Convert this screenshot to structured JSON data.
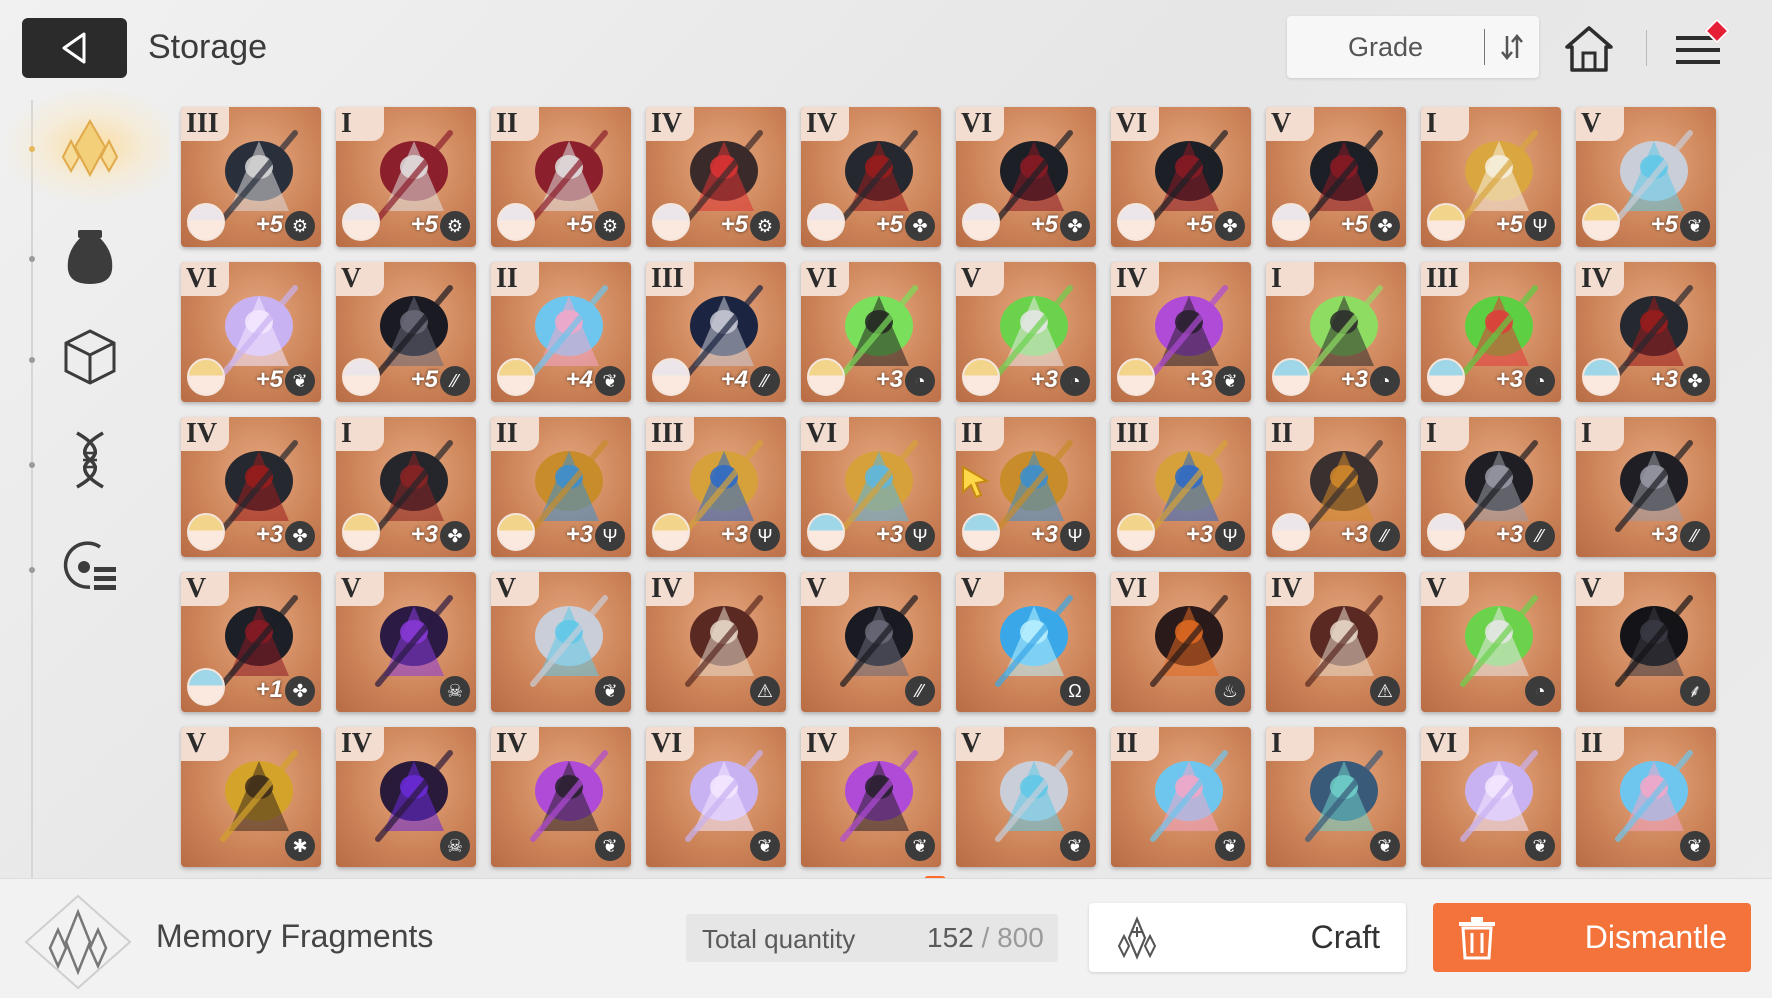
{
  "header": {
    "title": "Storage",
    "sort_label": "Grade"
  },
  "sidebar": {
    "tabs": [
      {
        "name": "memory-fragment-tab",
        "icon": "crystal-icon",
        "active": true
      },
      {
        "name": "pouch-tab",
        "icon": "pouch-icon",
        "active": false
      },
      {
        "name": "cube-tab",
        "icon": "cube-icon",
        "active": false
      },
      {
        "name": "dna-tab",
        "icon": "dna-icon",
        "active": false
      },
      {
        "name": "record-tab",
        "icon": "record-list-icon",
        "active": false
      }
    ]
  },
  "colors": {
    "card_bg": "#cd8459",
    "dismantle_accent": "#f4733a",
    "badge": "#e51f36"
  },
  "items": [
    {
      "grade": "III",
      "item": "goggles",
      "portrait": "white",
      "enh": "+5",
      "attr": "⚙"
    },
    {
      "grade": "I",
      "item": "staff",
      "portrait": "white",
      "enh": "+5",
      "attr": "⚙"
    },
    {
      "grade": "II",
      "item": "staff",
      "portrait": "white",
      "enh": "+5",
      "attr": "⚙"
    },
    {
      "grade": "IV",
      "item": "necklace",
      "portrait": "white",
      "enh": "+5",
      "attr": "⚙"
    },
    {
      "grade": "IV",
      "item": "spiked",
      "portrait": "white",
      "enh": "+5",
      "attr": "✤"
    },
    {
      "grade": "VI",
      "item": "claw",
      "portrait": "white",
      "enh": "+5",
      "attr": "✤"
    },
    {
      "grade": "VI",
      "item": "claw",
      "portrait": "white",
      "enh": "+5",
      "attr": "✤"
    },
    {
      "grade": "V",
      "item": "claw",
      "portrait": "white",
      "enh": "+5",
      "attr": "✤"
    },
    {
      "grade": "I",
      "item": "gold",
      "portrait": "blonde",
      "enh": "+5",
      "attr": "Ψ"
    },
    {
      "grade": "V",
      "item": "wand",
      "portrait": "blonde",
      "enh": "+5",
      "attr": "❦"
    },
    {
      "grade": "VI",
      "item": "feather",
      "portrait": "blonde",
      "enh": "+5",
      "attr": "❦"
    },
    {
      "grade": "V",
      "item": "goblet",
      "portrait": "white",
      "enh": "+5",
      "attr": "⁄⁄"
    },
    {
      "grade": "II",
      "item": "bow",
      "portrait": "blonde",
      "enh": "+4",
      "attr": "❦"
    },
    {
      "grade": "III",
      "item": "orb",
      "portrait": "white",
      "enh": "+4",
      "attr": "⁄⁄"
    },
    {
      "grade": "VI",
      "item": "vials",
      "portrait": "blonde",
      "enh": "+3",
      "attr": "◔"
    },
    {
      "grade": "V",
      "item": "potion",
      "portrait": "blonde",
      "enh": "+3",
      "attr": "◔"
    },
    {
      "grade": "IV",
      "item": "heart",
      "portrait": "blonde",
      "enh": "+3",
      "attr": "❦"
    },
    {
      "grade": "I",
      "item": "vial",
      "portrait": "blue",
      "enh": "+3",
      "attr": "◔"
    },
    {
      "grade": "III",
      "item": "flask",
      "portrait": "blue",
      "enh": "+3",
      "attr": "◔"
    },
    {
      "grade": "IV",
      "item": "spiked",
      "portrait": "blue",
      "enh": "+3",
      "attr": "✤"
    },
    {
      "grade": "IV",
      "item": "spiked",
      "portrait": "blonde",
      "enh": "+3",
      "attr": "✤"
    },
    {
      "grade": "I",
      "item": "chainclaw",
      "portrait": "blonde",
      "enh": "+3",
      "attr": "✤"
    },
    {
      "grade": "II",
      "item": "key",
      "portrait": "blonde",
      "enh": "+3",
      "attr": "Ψ"
    },
    {
      "grade": "III",
      "item": "trident",
      "portrait": "blonde",
      "enh": "+3",
      "attr": "Ψ"
    },
    {
      "grade": "VI",
      "item": "goldwing",
      "portrait": "blue",
      "enh": "+3",
      "attr": "Ψ"
    },
    {
      "grade": "II",
      "item": "key",
      "portrait": "blue",
      "enh": "+3",
      "attr": "Ψ"
    },
    {
      "grade": "III",
      "item": "trident",
      "portrait": "blonde",
      "enh": "+3",
      "attr": "Ψ"
    },
    {
      "grade": "II",
      "item": "gauntlet",
      "portrait": "white",
      "enh": "+3",
      "attr": "⁄⁄"
    },
    {
      "grade": "I",
      "item": "sword",
      "portrait": "white",
      "enh": "+3",
      "attr": "⁄⁄"
    },
    {
      "grade": "I",
      "item": "sword",
      "portrait": "",
      "enh": "+3",
      "attr": "⁄⁄"
    },
    {
      "grade": "V",
      "item": "claw",
      "portrait": "blue",
      "enh": "+1",
      "attr": "✤"
    },
    {
      "grade": "V",
      "item": "darkorb",
      "portrait": "",
      "enh": "",
      "attr": "☠"
    },
    {
      "grade": "V",
      "item": "wand",
      "portrait": "",
      "enh": "",
      "attr": "❦"
    },
    {
      "grade": "IV",
      "item": "charm",
      "portrait": "",
      "enh": "",
      "attr": "⚠"
    },
    {
      "grade": "V",
      "item": "goblet",
      "portrait": "",
      "enh": "",
      "attr": "⁄⁄"
    },
    {
      "grade": "V",
      "item": "water",
      "portrait": "",
      "enh": "",
      "attr": "Ω"
    },
    {
      "grade": "VI",
      "item": "flame",
      "portrait": "",
      "enh": "",
      "attr": "♨"
    },
    {
      "grade": "IV",
      "item": "charm",
      "portrait": "",
      "enh": "",
      "attr": "⚠"
    },
    {
      "grade": "V",
      "item": "potion",
      "portrait": "",
      "enh": "",
      "attr": "◔"
    },
    {
      "grade": "V",
      "item": "darkgoblet",
      "portrait": "",
      "enh": "",
      "attr": "⸙"
    },
    {
      "grade": "V",
      "item": "trophy",
      "portrait": "",
      "enh": "",
      "attr": "✱"
    },
    {
      "grade": "IV",
      "item": "darkchain",
      "portrait": "",
      "enh": "",
      "attr": "☠"
    },
    {
      "grade": "IV",
      "item": "heart",
      "portrait": "",
      "enh": "",
      "attr": "❦"
    },
    {
      "grade": "VI",
      "item": "feather",
      "portrait": "",
      "enh": "",
      "attr": "❦"
    },
    {
      "grade": "IV",
      "item": "heart",
      "portrait": "",
      "enh": "",
      "attr": "❦"
    },
    {
      "grade": "V",
      "item": "wand",
      "portrait": "",
      "enh": "",
      "attr": "❦"
    },
    {
      "grade": "II",
      "item": "bow",
      "portrait": "",
      "enh": "",
      "attr": "❦"
    },
    {
      "grade": "I",
      "item": "crossbow",
      "portrait": "",
      "enh": "",
      "attr": "❦"
    },
    {
      "grade": "VI",
      "item": "feather",
      "portrait": "",
      "enh": "",
      "attr": "❦"
    },
    {
      "grade": "II",
      "item": "bow",
      "portrait": "",
      "enh": "",
      "attr": "❦"
    }
  ],
  "footer": {
    "category_label": "Memory Fragments",
    "total_label": "Total quantity",
    "total_current": "152",
    "total_sep": " / ",
    "total_max": "800",
    "craft_label": "Craft",
    "dismantle_label": "Dismantle"
  }
}
